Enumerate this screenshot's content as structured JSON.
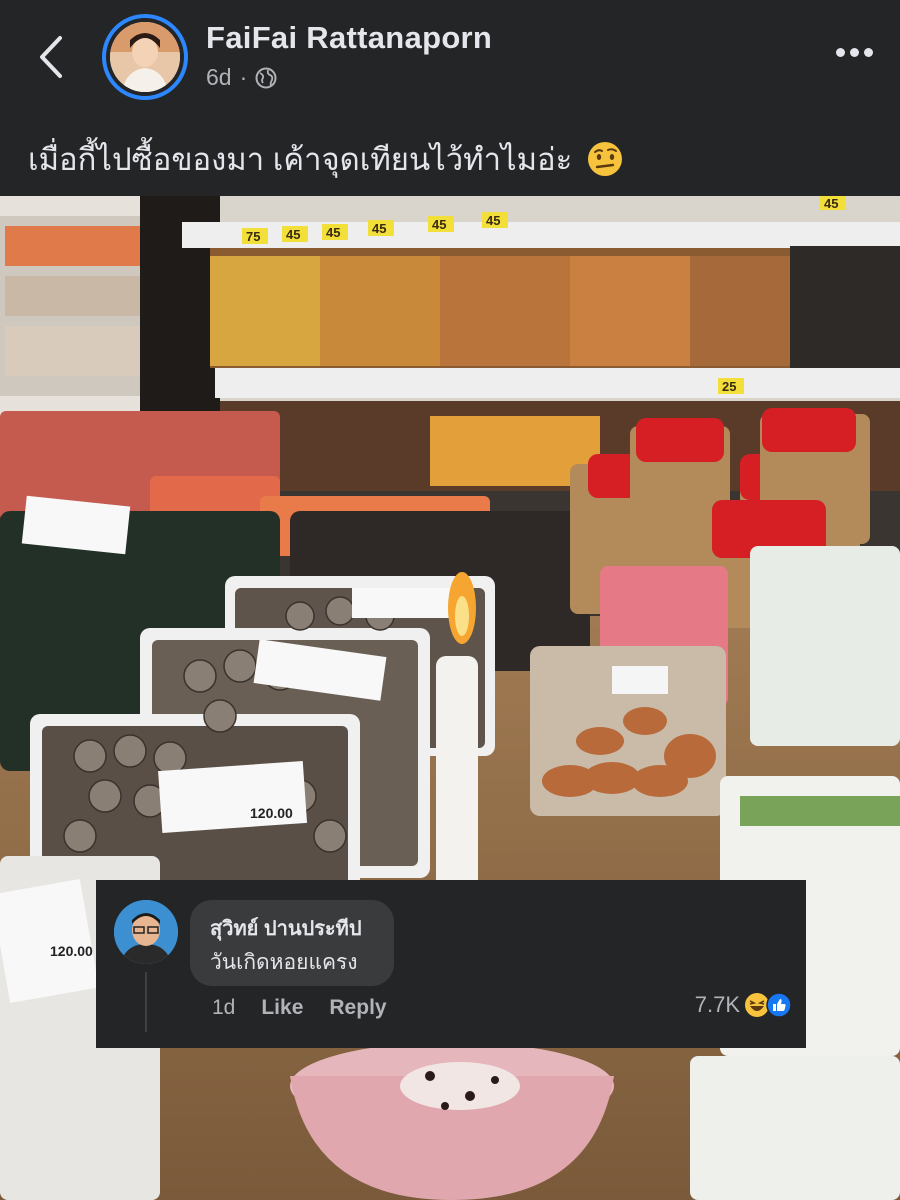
{
  "post": {
    "author": "FaiFai Rattanaporn",
    "time": "6d",
    "separator": "·",
    "caption": "เมื่อกี้ไปซื้อของมา เค้าจุดเทียนไว้ทำไมอ่ะ"
  },
  "photo_price_tags": [
    "75",
    "45",
    "45",
    "45",
    "45",
    "45",
    "25",
    "45",
    "120.00",
    "120.00"
  ],
  "comment": {
    "author": "สุวิทย์ ปานประทีป",
    "text": "วันเกิดหอยแครง",
    "time": "1d",
    "like_label": "Like",
    "reply_label": "Reply",
    "reaction_count": "7.7K"
  },
  "colors": {
    "background": "#242526",
    "accent": "#2d88ff",
    "bubble": "#3a3b3c",
    "muted": "#b0b3b8"
  },
  "icons": [
    "back-arrow-icon",
    "globe-icon",
    "more-icon",
    "thinking-face-emoji-icon",
    "haha-reaction-icon",
    "like-reaction-icon"
  ]
}
